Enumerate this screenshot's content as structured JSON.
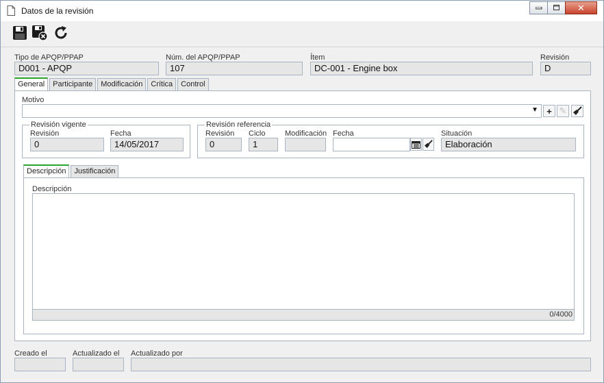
{
  "window": {
    "title": "Datos de la revisión",
    "controls": {
      "minimize": "▭",
      "maximize": "□",
      "close": "✕"
    }
  },
  "toolbar": {
    "save_icon": "save-icon",
    "save_close_icon": "save-and-close-icon",
    "refresh_icon": "refresh-icon"
  },
  "header": {
    "type_label": "Tipo de APQP/PPAP",
    "type_value": "D001 - APQP",
    "number_label": "Núm. del APQP/PPAP",
    "number_value": "107",
    "item_label": "Ítem",
    "item_value": "DC-001 - Engine box",
    "revision_label": "Revisión",
    "revision_value": "D"
  },
  "tabs": [
    "General",
    "Participante",
    "Modificación",
    "Crítica",
    "Control"
  ],
  "general": {
    "motivo_label": "Motivo",
    "motivo_value": "",
    "revision_vigente": {
      "title": "Revisión vigente",
      "revision_label": "Revisión",
      "revision_value": "0",
      "fecha_label": "Fecha",
      "fecha_value": "14/05/2017"
    },
    "revision_referencia": {
      "title": "Revisión referencia",
      "revision_label": "Revisión",
      "revision_value": "0",
      "ciclo_label": "Ciclo",
      "ciclo_value": "1",
      "modificacion_label": "Modificación",
      "modificacion_value": "",
      "fecha_label": "Fecha",
      "fecha_value": "",
      "situacion_label": "Situación",
      "situacion_value": "Elaboración"
    },
    "subtabs": [
      "Descripción",
      "Justificación"
    ],
    "descripcion_label": "Descripción",
    "descripcion_value": "",
    "counter": "0/4000"
  },
  "footer": {
    "creado_label": "Creado el",
    "creado_value": "",
    "actualizado_label": "Actualizado el",
    "actualizado_value": "",
    "actualizado_por_label": "Actualizado por",
    "actualizado_por_value": ""
  }
}
